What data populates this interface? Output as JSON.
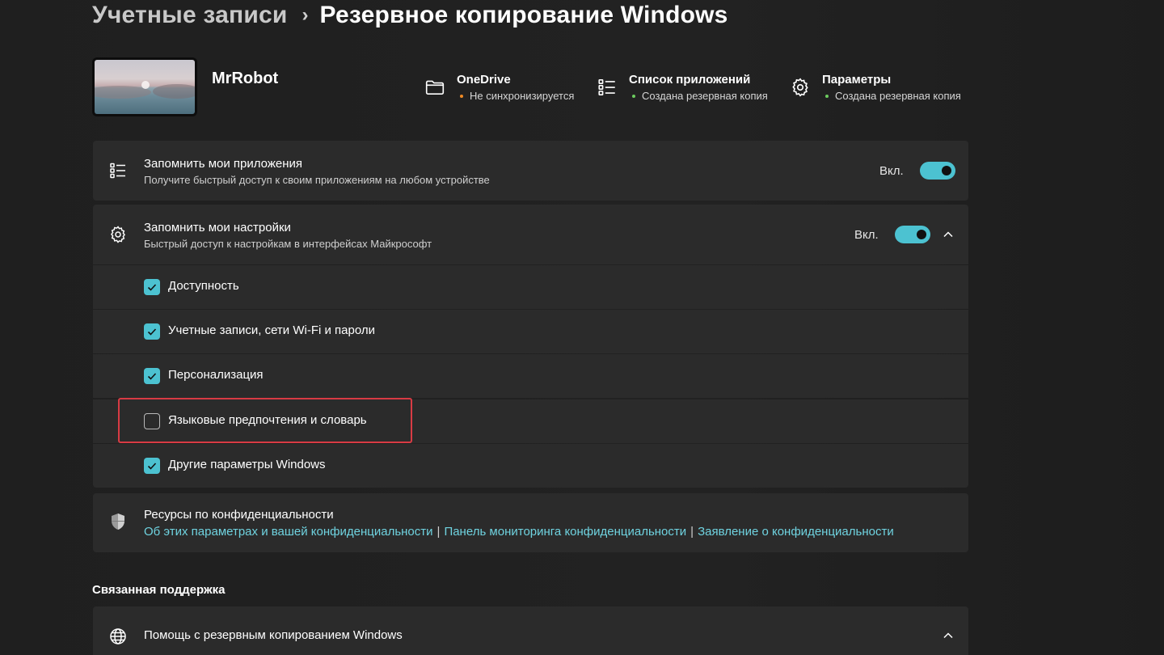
{
  "breadcrumb": {
    "parent": "Учетные записи",
    "separator": "›",
    "current": "Резервное копирование Windows"
  },
  "account": {
    "username": "MrRobot"
  },
  "status_items": [
    {
      "icon": "folder-icon",
      "title": "OneDrive",
      "subtitle": "Не синхронизируется",
      "dot_color": "#f08a24"
    },
    {
      "icon": "list-icon",
      "title": "Список приложений",
      "subtitle": "Создана резервная копия",
      "dot_color": "#6ccb5f"
    },
    {
      "icon": "gear-icon",
      "title": "Параметры",
      "subtitle": "Создана резервная копия",
      "dot_color": "#6ccb5f"
    }
  ],
  "remember_apps": {
    "icon": "list-icon",
    "title": "Запомнить мои приложения",
    "description": "Получите быстрый доступ к своим приложениям на любом устройстве",
    "toggle_label": "Вкл.",
    "toggle_on": true
  },
  "remember_settings": {
    "icon": "gear-icon",
    "title": "Запомнить мои настройки",
    "description": "Быстрый доступ к настройкам в интерфейсах Майкрософт",
    "toggle_label": "Вкл.",
    "toggle_on": true,
    "expanded": true,
    "options": [
      {
        "label": "Доступность",
        "checked": true
      },
      {
        "label": "Учетные записи, сети Wi-Fi и пароли",
        "checked": true
      },
      {
        "label": "Персонализация",
        "checked": true
      },
      {
        "label": "Языковые предпочтения и словарь",
        "checked": false
      },
      {
        "label": "Другие параметры Windows",
        "checked": true
      }
    ]
  },
  "privacy": {
    "icon": "shield-icon",
    "title": "Ресурсы по конфиденциальности",
    "links": [
      "Об этих параметрах и вашей конфиденциальности",
      "Панель мониторинга конфиденциальности",
      "Заявление о конфиденциальности"
    ],
    "link_separator": "|"
  },
  "related_support": {
    "section_title": "Связанная поддержка",
    "items": [
      {
        "icon": "globe-icon",
        "title": "Помощь с резервным копированием Windows"
      }
    ]
  },
  "colors": {
    "accent": "#4cc2d1",
    "link": "#6fd3e0",
    "highlight": "#d83b44",
    "card": "#2b2b2b",
    "background": "#202020"
  }
}
